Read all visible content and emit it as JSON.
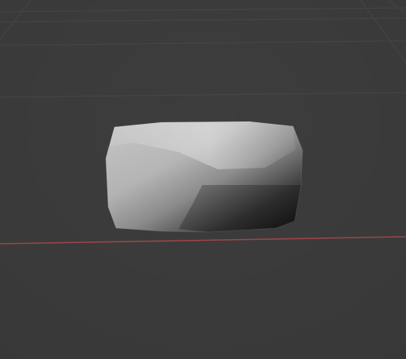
{
  "viewport": {
    "background_color": "#3d3d3d",
    "grid": {
      "visible": true,
      "line_color": "#4a4a4a",
      "x_axis_color": "#b24a4a"
    },
    "selected_object": {
      "kind": "mesh-object",
      "shading": "smooth-gradient"
    }
  }
}
